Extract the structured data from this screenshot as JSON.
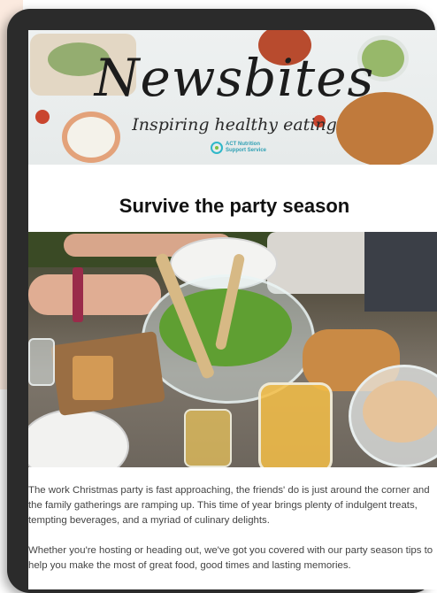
{
  "newsletter": {
    "brand_title": "Newsbites",
    "tagline": "Inspiring healthy eating",
    "logo_text_line1": "ACT Nutrition",
    "logo_text_line2": "Support Service",
    "headline": "Survive the party season",
    "paragraphs": [
      "The work Christmas party is fast approaching, the friends' do is just around the corner and the family gatherings are ramping up. This time of year brings plenty of indulgent treats, tempting beverages, and a myriad of culinary delights.",
      "Whether you're hosting or heading out, we've got you covered with our party season tips to help you make the most of great food, good times and lasting memories."
    ]
  },
  "colors": {
    "device_frame": "#2b2b2b",
    "peach_background": "#fbeadf",
    "logo_teal": "#2fb8c9",
    "logo_green": "#7bc043",
    "headline": "#111111",
    "body_text": "#444444"
  }
}
